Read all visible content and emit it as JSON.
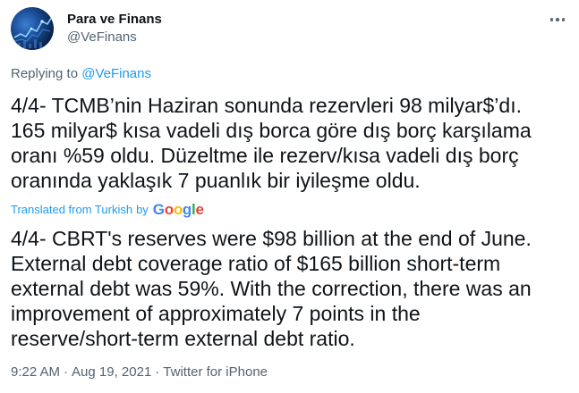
{
  "author": {
    "display_name": "Para ve Finans",
    "handle": "@VeFinans",
    "avatar_icon": "finance-chart-avatar"
  },
  "more_icon": "ellipsis-icon",
  "replying": {
    "prefix": "Replying to ",
    "handle": "@VeFinans"
  },
  "tweet": {
    "text": "4/4- TCMB’nin Haziran sonunda rezervleri 98 milyar$’dı.\n165 milyar$ kısa vadeli dış borca göre dış borç karşılama\noranı %59 oldu. Düzeltme ile rezerv/kısa vadeli dış borç\noranında yaklaşık 7 puanlık bir iyileşme oldu."
  },
  "translation": {
    "label": "Translated from Turkish",
    "by": "by",
    "provider": [
      "G",
      "o",
      "o",
      "g",
      "l",
      "e"
    ],
    "text": "4/4- CBRT's reserves were $98 billion at the end of June.\nExternal debt coverage ratio of $165 billion short-term\nexternal debt was 59%. With the correction, there was an\nimprovement of approximately 7 points in the\nreserve/short-term external debt ratio."
  },
  "meta": {
    "time": "9:22 AM",
    "separator": "·",
    "date": "Aug 19, 2021",
    "source": "Twitter for iPhone"
  },
  "colors": {
    "link": "#1d9bf0",
    "secondary_text": "#536471",
    "primary_text": "#0f1419"
  }
}
